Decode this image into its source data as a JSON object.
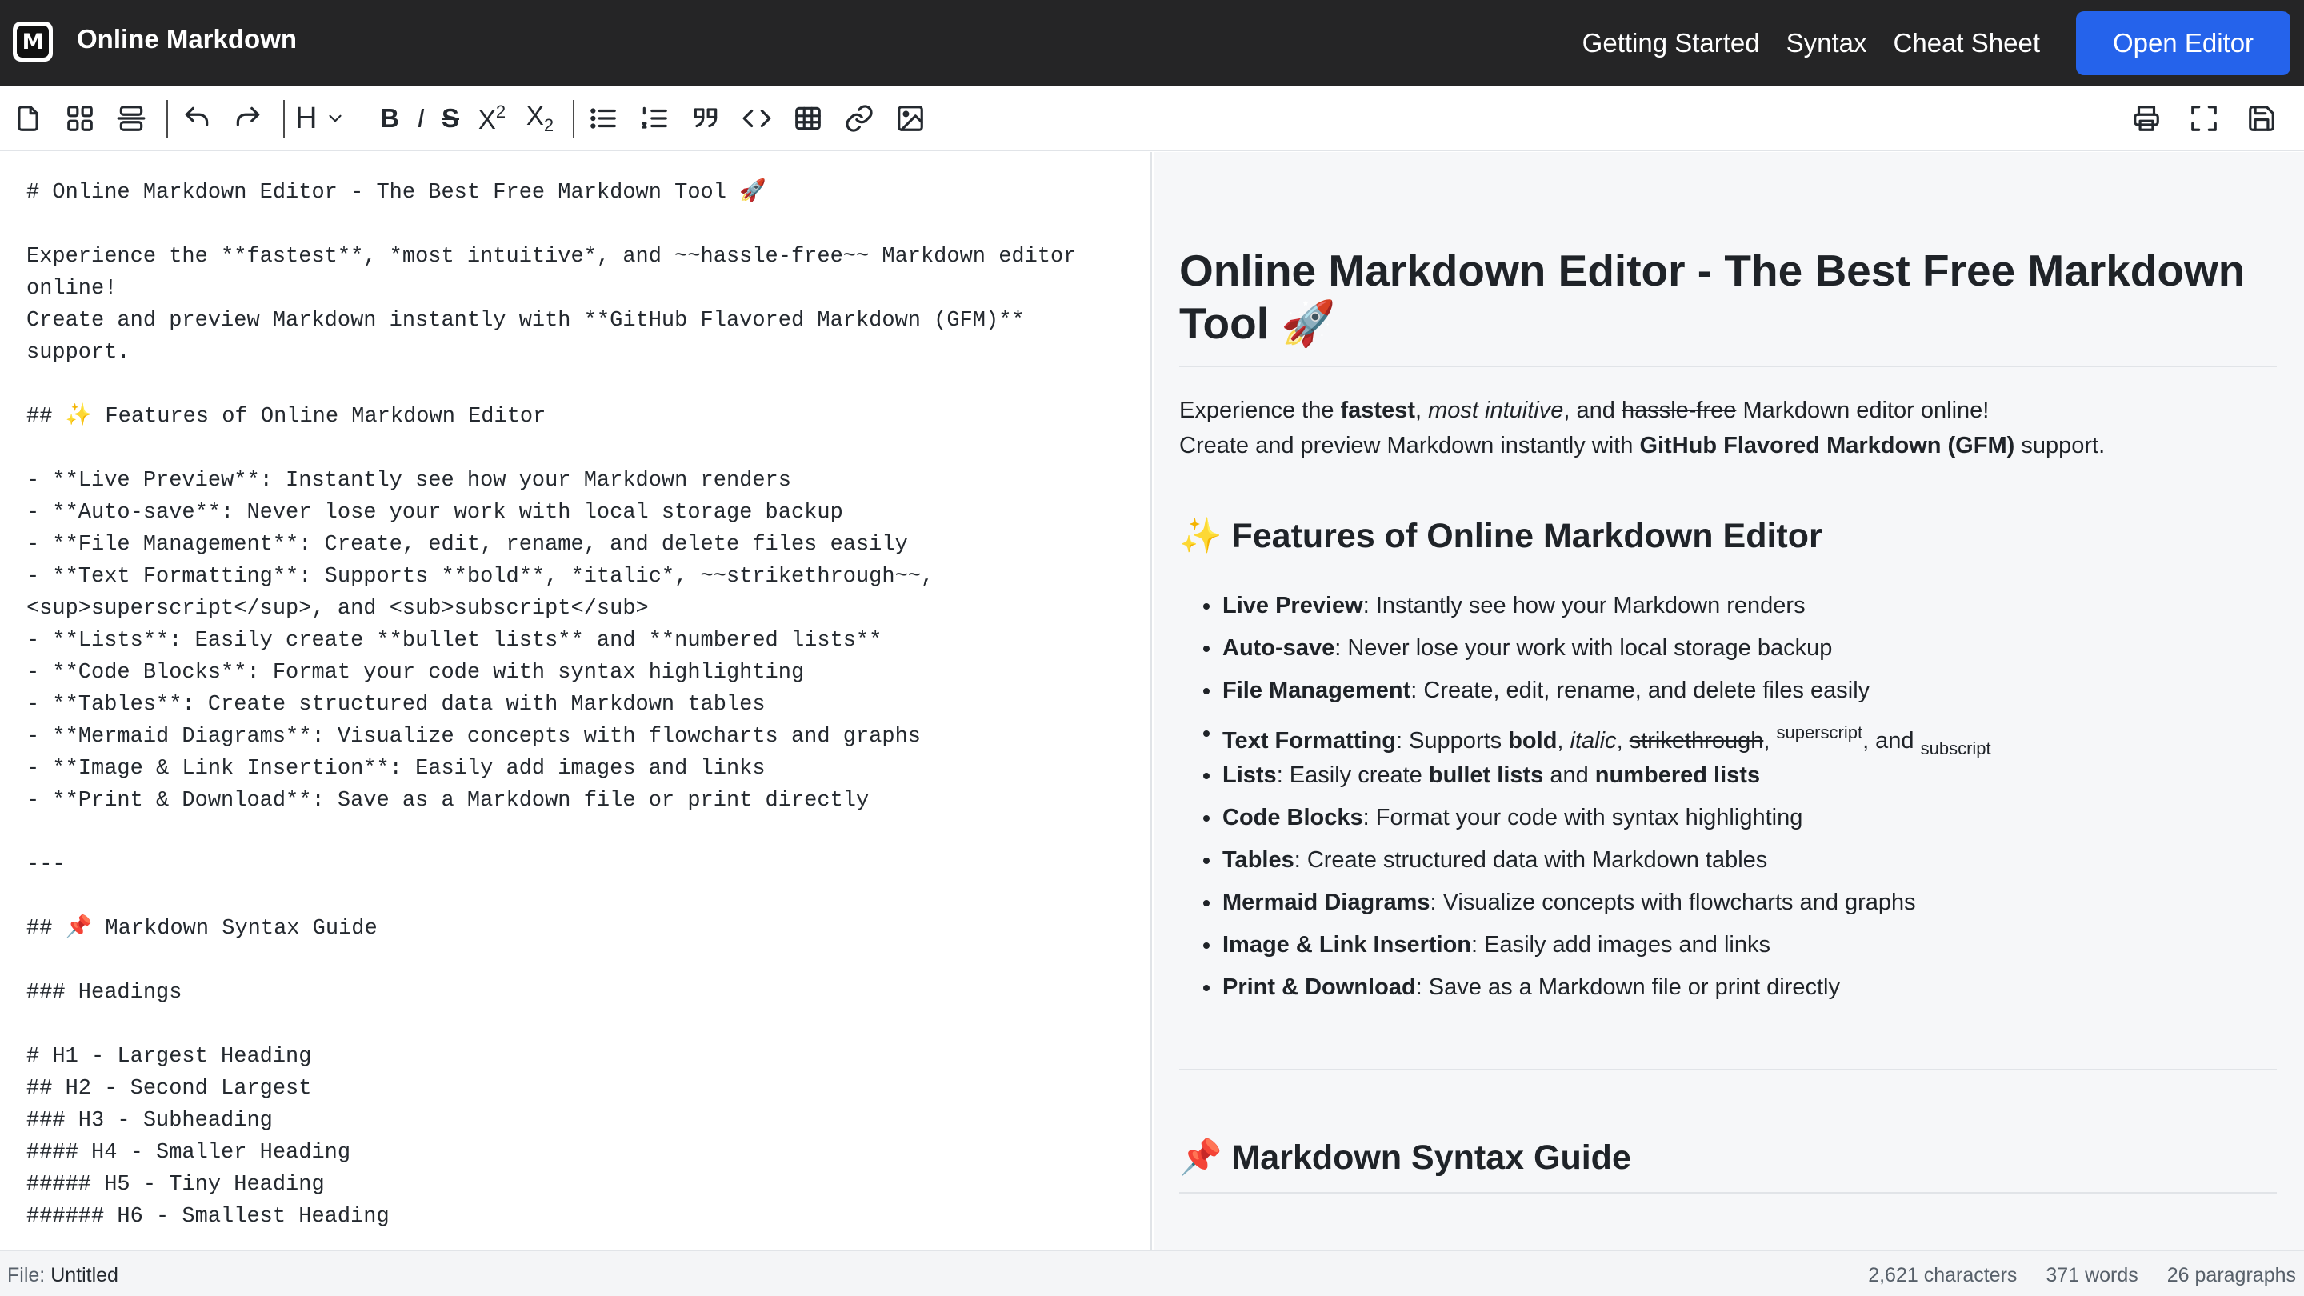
{
  "app": {
    "logo_letter": "M",
    "title": "Online Markdown"
  },
  "nav": {
    "links": [
      "Getting Started",
      "Syntax",
      "Cheat Sheet"
    ],
    "open_editor": "Open Editor",
    "accent_color": "#2563eb"
  },
  "toolbar": {
    "buttons": [
      {
        "icon": "new-file-icon"
      },
      {
        "icon": "grid-icon"
      },
      {
        "icon": "split-icon"
      },
      {
        "icon": "undo-icon"
      },
      {
        "icon": "redo-icon"
      },
      {
        "icon": "heading-icon",
        "label": "H"
      },
      {
        "icon": "bold-icon",
        "label": "B"
      },
      {
        "icon": "italic-icon",
        "label": "I"
      },
      {
        "icon": "strikethrough-icon",
        "label": "S"
      },
      {
        "icon": "superscript-icon",
        "label": "X",
        "sup": "2"
      },
      {
        "icon": "subscript-icon",
        "label": "X",
        "sub": "2"
      },
      {
        "icon": "bullet-list-icon"
      },
      {
        "icon": "numbered-list-icon"
      },
      {
        "icon": "quote-icon"
      },
      {
        "icon": "code-icon"
      },
      {
        "icon": "table-icon"
      },
      {
        "icon": "link-icon"
      },
      {
        "icon": "image-icon"
      },
      {
        "icon": "print-icon"
      },
      {
        "icon": "fullscreen-icon"
      },
      {
        "icon": "save-icon"
      }
    ]
  },
  "editor": {
    "lines": [
      "# Online Markdown Editor - The Best Free Markdown Tool 🚀",
      "",
      "Experience the **fastest**, *most intuitive*, and ~~hassle-free~~ Markdown editor",
      "online!",
      "Create and preview Markdown instantly with **GitHub Flavored Markdown (GFM)**",
      "support.",
      "",
      "## ✨ Features of Online Markdown Editor",
      "",
      "- **Live Preview**: Instantly see how your Markdown renders",
      "- **Auto-save**: Never lose your work with local storage backup",
      "- **File Management**: Create, edit, rename, and delete files easily",
      "- **Text Formatting**: Supports **bold**, *italic*, ~~strikethrough~~,",
      "<sup>superscript</sup>, and <sub>subscript</sub>",
      "- **Lists**: Easily create **bullet lists** and **numbered lists**",
      "- **Code Blocks**: Format your code with syntax highlighting",
      "- **Tables**: Create structured data with Markdown tables",
      "- **Mermaid Diagrams**: Visualize concepts with flowcharts and graphs",
      "- **Image & Link Insertion**: Easily add images and links",
      "- **Print & Download**: Save as a Markdown file or print directly",
      "",
      "---",
      "",
      "## 📌 Markdown Syntax Guide",
      "",
      "### Headings",
      "",
      "# H1 - Largest Heading",
      "## H2 - Second Largest",
      "### H3 - Subheading",
      "#### H4 - Smaller Heading",
      "##### H5 - Tiny Heading",
      "###### H6 - Smallest Heading"
    ]
  },
  "preview": {
    "h1_line1": "Online Markdown Editor - The Best Free Markdown",
    "h1_line2": "Tool 🚀",
    "intro": {
      "p1_a": "Experience the ",
      "p1_b": "fastest",
      "p1_c": ", ",
      "p1_d": "most intuitive",
      "p1_e": ", and ",
      "p1_f": "hassle-free",
      "p1_g": " Markdown editor online!",
      "p2_a": "Create and preview Markdown instantly with ",
      "p2_b": "GitHub Flavored Markdown (GFM)",
      "p2_c": " support."
    },
    "features_heading": "✨ Features of Online Markdown Editor",
    "features": [
      {
        "term": "Live Preview",
        "desc": ": Instantly see how your Markdown renders"
      },
      {
        "term": "Auto-save",
        "desc": ": Never lose your work with local storage backup"
      },
      {
        "term": "File Management",
        "desc": ": Create, edit, rename, and delete files easily"
      },
      {
        "term": "Text Formatting",
        "desc": ": Supports ",
        "bold": "bold",
        "sep1": ", ",
        "italic": "italic",
        "sep2": ", ",
        "strike": "strikethrough",
        "sep3": ", ",
        "sup": "superscript",
        "sep4": ", and ",
        "sub": "subscript"
      },
      {
        "term": "Lists",
        "desc": ": Easily create ",
        "b1": "bullet lists",
        "mid": " and ",
        "b2": "numbered lists"
      },
      {
        "term": "Code Blocks",
        "desc": ": Format your code with syntax highlighting"
      },
      {
        "term": "Tables",
        "desc": ": Create structured data with Markdown tables"
      },
      {
        "term": "Mermaid Diagrams",
        "desc": ": Visualize concepts with flowcharts and graphs"
      },
      {
        "term": "Image & Link Insertion",
        "desc": ": Easily add images and links"
      },
      {
        "term": "Print & Download",
        "desc": ": Save as a Markdown file or print directly"
      }
    ],
    "syntax_heading": "📌 Markdown Syntax Guide"
  },
  "status": {
    "file_label": "File: ",
    "file_name": "Untitled",
    "characters": "2,621 characters",
    "words": "371 words",
    "paragraphs": "26 paragraphs"
  }
}
